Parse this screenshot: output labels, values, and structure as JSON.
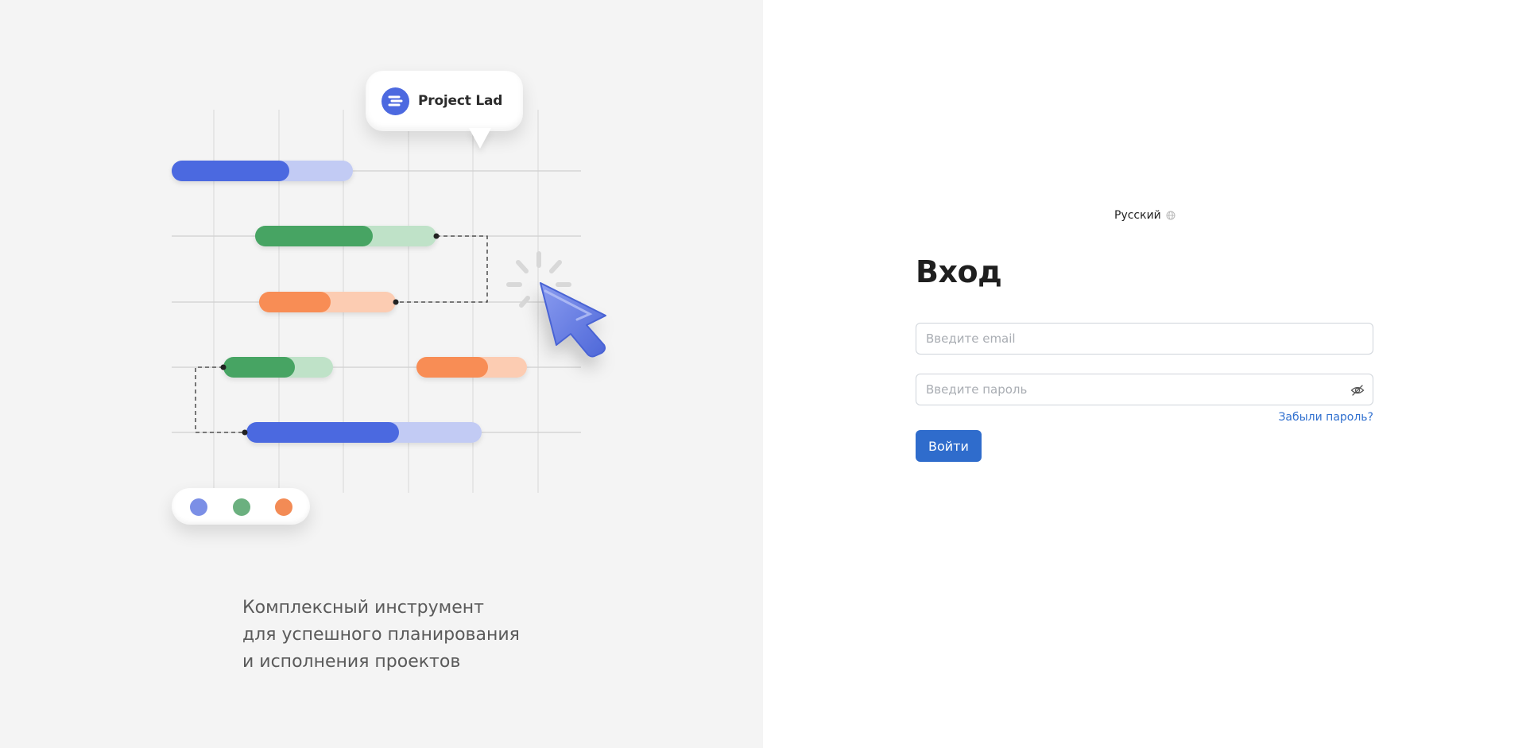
{
  "brand": {
    "name": "Project Lad",
    "accent": "#4c69e0"
  },
  "promo": {
    "tagline": "Комплексный инструмент\nдля успешного планирования\nи исполнения проектов"
  },
  "legend": {
    "colors": [
      "#7b8fe6",
      "#6bb07f",
      "#f38b55"
    ]
  },
  "language": {
    "current": "Русский",
    "icon": "globe-icon"
  },
  "login": {
    "title": "Вход",
    "email_placeholder": "Введите email",
    "password_placeholder": "Введите пароль",
    "password_toggle_icon": "eye-slash-icon",
    "forgot_link": "Забыли пароль?",
    "submit_label": "Войти",
    "primary_color": "#2f6ccc",
    "link_color": "#2f6fcf"
  }
}
